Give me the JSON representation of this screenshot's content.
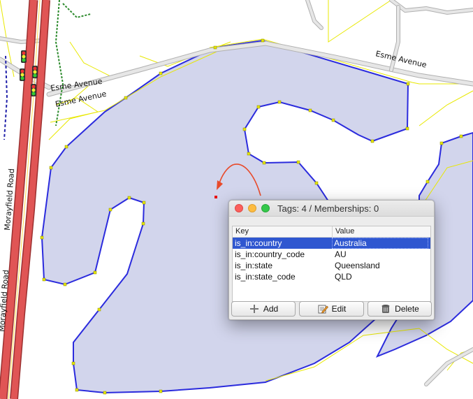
{
  "map": {
    "road_labels": {
      "esme_avenue_1": "Esme Avenue",
      "esme_avenue_2": "Esme Avenue",
      "esme_avenue_3": "Esme Avenue",
      "moorfield_road": "Morayfield Road",
      "moorfield_road_2": "Morayfield Road"
    },
    "colors": {
      "water_fill": "#d2d5ec",
      "way_outline": "#2b2bdd",
      "road_gray": "#c8c8c8",
      "road_casing": "#e2e2a0",
      "yellow_track": "#e8e800",
      "highway_red": "#e05050",
      "direction_arrow": "#e84a2a"
    }
  },
  "dialog": {
    "title": "Tags: 4 / Memberships: 0",
    "columns": {
      "key": "Key",
      "value": "Value"
    },
    "rows": [
      {
        "key": "is_in:country",
        "value": "Australia",
        "selected": true
      },
      {
        "key": "is_in:country_code",
        "value": "AU",
        "selected": false
      },
      {
        "key": "is_in:state",
        "value": "Queensland",
        "selected": false
      },
      {
        "key": "is_in:state_code",
        "value": "QLD",
        "selected": false
      }
    ],
    "buttons": {
      "add": "Add",
      "edit": "Edit",
      "delete": "Delete"
    },
    "colors": {
      "selection": "#2f57d0",
      "close": "#fc605c",
      "minimize": "#fdbc40",
      "maximize": "#34c84a"
    }
  }
}
